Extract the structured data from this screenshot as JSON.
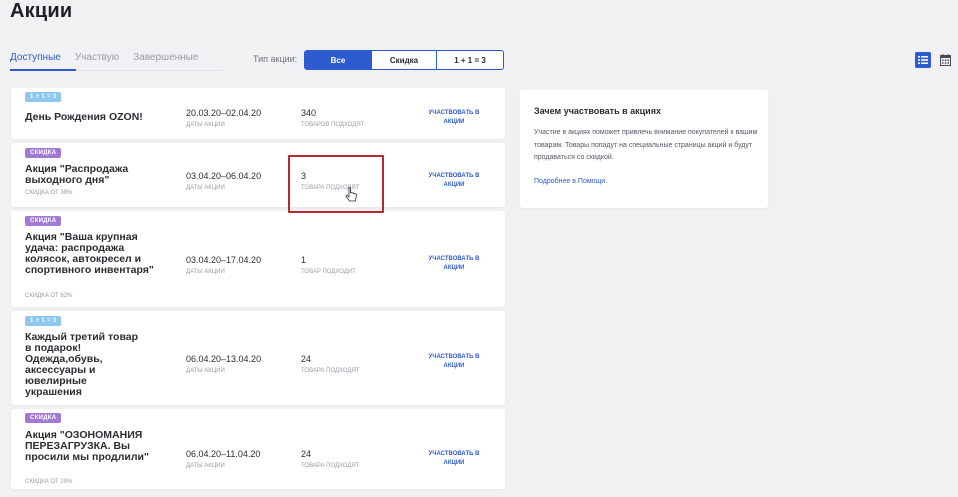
{
  "page": {
    "title": "Акции"
  },
  "tabs": [
    {
      "label": "Доступные",
      "active": true
    },
    {
      "label": "Участвую",
      "active": false
    },
    {
      "label": "Завершенные",
      "active": false
    }
  ],
  "filter": {
    "label": "Тип акции:",
    "options": [
      {
        "label": "Все",
        "active": true
      },
      {
        "label": "Скидка",
        "active": false
      },
      {
        "label": "1 + 1 = 3",
        "active": false
      }
    ]
  },
  "view": {
    "list_icon": "list-view-icon",
    "calendar_icon": "calendar-icon"
  },
  "promotions": [
    {
      "badge": "1 + 1 = 3",
      "badge_type": "promo",
      "title": "День Рождения OZON!",
      "subtitle": "",
      "dates": "20.03.20–02.04.20",
      "dates_label": "ДАТЫ АКЦИИ",
      "count": "340",
      "count_label": "ТОВАРОВ ПОДХОДЯТ",
      "action": "УЧАСТВОВАТЬ В АКЦИИ"
    },
    {
      "badge": "СКИДКА",
      "badge_type": "sale",
      "title": "Акция \"Распродажа выходного дня\"",
      "subtitle": "СКИДКА ОТ 39%",
      "dates": "03.04.20–06.04.20",
      "dates_label": "ДАТЫ АКЦИИ",
      "count": "3",
      "count_label": "ТОВАРА ПОДХОДЯТ",
      "action": "УЧАСТВОВАТЬ В АКЦИИ"
    },
    {
      "badge": "СКИДКА",
      "badge_type": "sale",
      "title": "Акция \"Ваша крупная удача: распродажа колясок, автокресел и спортивного инвентаря\"",
      "subtitle": "СКИДКА ОТ 62%",
      "dates": "03.04.20–17.04.20",
      "dates_label": "ДАТЫ АКЦИИ",
      "count": "1",
      "count_label": "ТОВАР ПОДХОДИТ",
      "action": "УЧАСТВОВАТЬ В АКЦИИ"
    },
    {
      "badge": "1 + 1 = 3",
      "badge_type": "promo",
      "title": "Каждый третий товар в подарок! Одежда,обувь, аксессуары и ювелирные украшения",
      "subtitle": "",
      "dates": "06.04.20–13.04.20",
      "dates_label": "ДАТЫ АКЦИИ",
      "count": "24",
      "count_label": "ТОВАРА ПОДХОДЯТ",
      "action": "УЧАСТВОВАТЬ В АКЦИИ"
    },
    {
      "badge": "СКИДКА",
      "badge_type": "sale",
      "title": "Акция \"ОЗОНОМАНИЯ ПЕРЕЗАГРУЗКА. Вы просили мы продлили\"",
      "subtitle": "СКИДКА ОТ 20%",
      "dates": "06.04.20–11.04.20",
      "dates_label": "ДАТЫ АКЦИИ",
      "count": "24",
      "count_label": "ТОВАРА ПОДХОДЯТ",
      "action": "УЧАСТВОВАТЬ В АКЦИИ"
    }
  ],
  "info": {
    "title": "Зачем участвовать в акциях",
    "text": "Участие в акциях поможет привлечь внимание покупателей к вашим товарам. Товары попадут на специальные страницы акций и будут продаваться со скидкой.",
    "link": "Подробнее в Помощи."
  },
  "colors": {
    "accent": "#2d5bd0",
    "sale_badge": "#a27ad6",
    "promo_badge": "#8ec6ef",
    "highlight": "#b9282f"
  }
}
